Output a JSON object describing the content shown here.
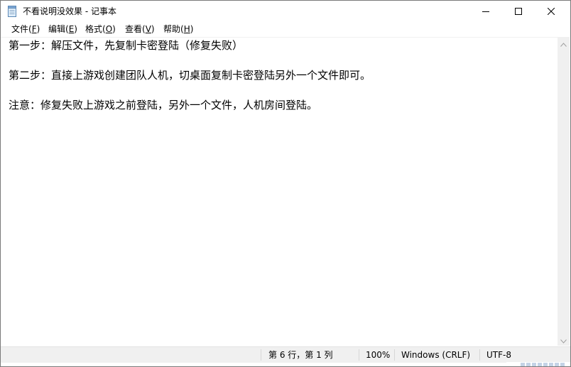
{
  "window": {
    "title": "不看说明没效果 - 记事本",
    "app_icon": "notepad-icon",
    "controls": {
      "minimize": "minimize-icon",
      "maximize": "maximize-icon",
      "close": "close-icon"
    }
  },
  "menu": {
    "file": {
      "label": "文件(",
      "key": "F",
      "end": ")"
    },
    "edit": {
      "label": "编辑(",
      "key": "E",
      "end": ")"
    },
    "format": {
      "label": "格式(",
      "key": "O",
      "end": ")"
    },
    "view": {
      "label": "查看(",
      "key": "V",
      "end": ")"
    },
    "help": {
      "label": "帮助(",
      "key": "H",
      "end": ")"
    }
  },
  "document": {
    "lines": [
      "第一步：解压文件，先复制卡密登陆（修复失败）",
      "",
      "第二步：直接上游戏创建团队人机，切桌面复制卡密登陆另外一个文件即可。",
      "",
      "注意：修复失败上游戏之前登陆，另外一个文件，人机房间登陆。"
    ]
  },
  "status": {
    "position": "第 6 行，第 1 列",
    "zoom": "100%",
    "line_ending": "Windows (CRLF)",
    "encoding": "UTF-8"
  },
  "colors": {
    "background": "#ffffff",
    "chrome": "#f0f0f0",
    "text": "#000000"
  }
}
